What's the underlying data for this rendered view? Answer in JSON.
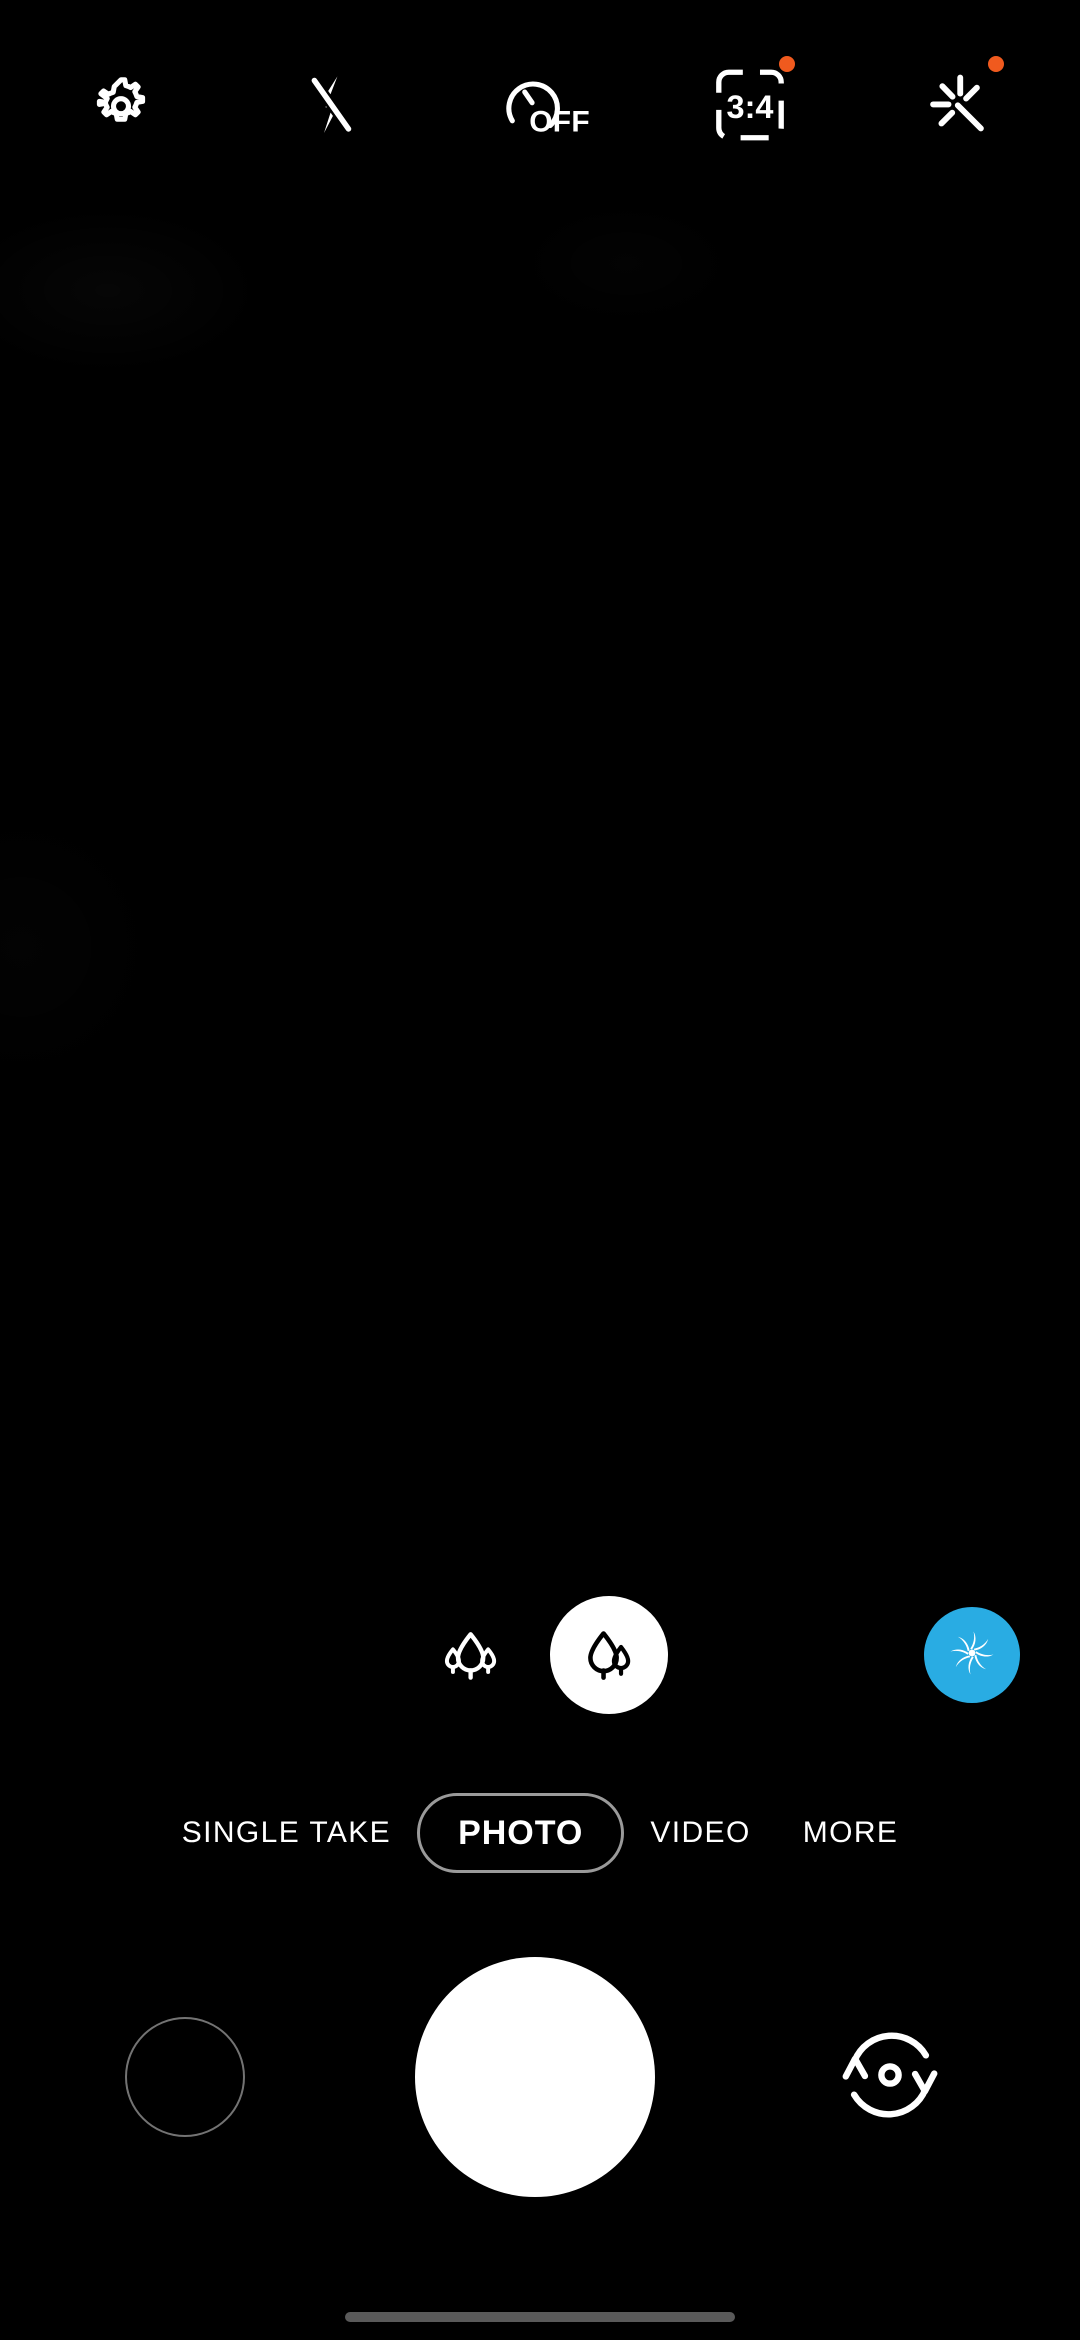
{
  "app": {
    "name": "Camera",
    "background_color": "#000000",
    "foreground_color": "#ffffff"
  },
  "top_bar": {
    "buttons": [
      {
        "id": "settings",
        "icon": "gear-icon",
        "label": "Settings",
        "badge": false
      },
      {
        "id": "flash",
        "icon": "flash-off-icon",
        "label": "Flash off",
        "value": "off",
        "badge": false
      },
      {
        "id": "timer",
        "icon": "timer-icon",
        "label": "Timer",
        "value": "OFF",
        "badge": false
      },
      {
        "id": "aspect_ratio",
        "icon": "aspect-ratio-icon",
        "label": "Aspect ratio",
        "value": "3:4",
        "badge": true,
        "badge_color": "#F05A1E"
      },
      {
        "id": "filters",
        "icon": "magic-wand-icon",
        "label": "Filters and effects",
        "badge": true,
        "badge_color": "#F05A1E"
      }
    ]
  },
  "lens_selector": {
    "options": [
      {
        "id": "ultra_wide",
        "icon": "trees-three-icon",
        "label": "Ultra wide lens",
        "selected": false
      },
      {
        "id": "wide",
        "icon": "trees-two-icon",
        "label": "Wide lens",
        "selected": true
      }
    ],
    "effect_button": {
      "id": "bokeh",
      "icon": "aperture-swirl-icon",
      "label": "Portrait effect",
      "color": "#29ACE3",
      "active": true
    }
  },
  "mode_tabs": {
    "items": [
      {
        "id": "single_take",
        "label": "SINGLE TAKE",
        "selected": false
      },
      {
        "id": "photo",
        "label": "PHOTO",
        "selected": true
      },
      {
        "id": "video",
        "label": "VIDEO",
        "selected": false
      },
      {
        "id": "more",
        "label": "MORE",
        "selected": false
      }
    ]
  },
  "shutter_row": {
    "gallery": {
      "id": "gallery",
      "icon": "gallery-thumbnail",
      "label": "Gallery preview"
    },
    "shutter": {
      "id": "shutter",
      "icon": "shutter-button",
      "label": "Take photo"
    },
    "flip": {
      "id": "flip_camera",
      "icon": "flip-camera-icon",
      "label": "Switch camera"
    }
  },
  "system": {
    "home_indicator": {
      "label": "Home gesture bar",
      "color": "#5a5a5a"
    }
  }
}
